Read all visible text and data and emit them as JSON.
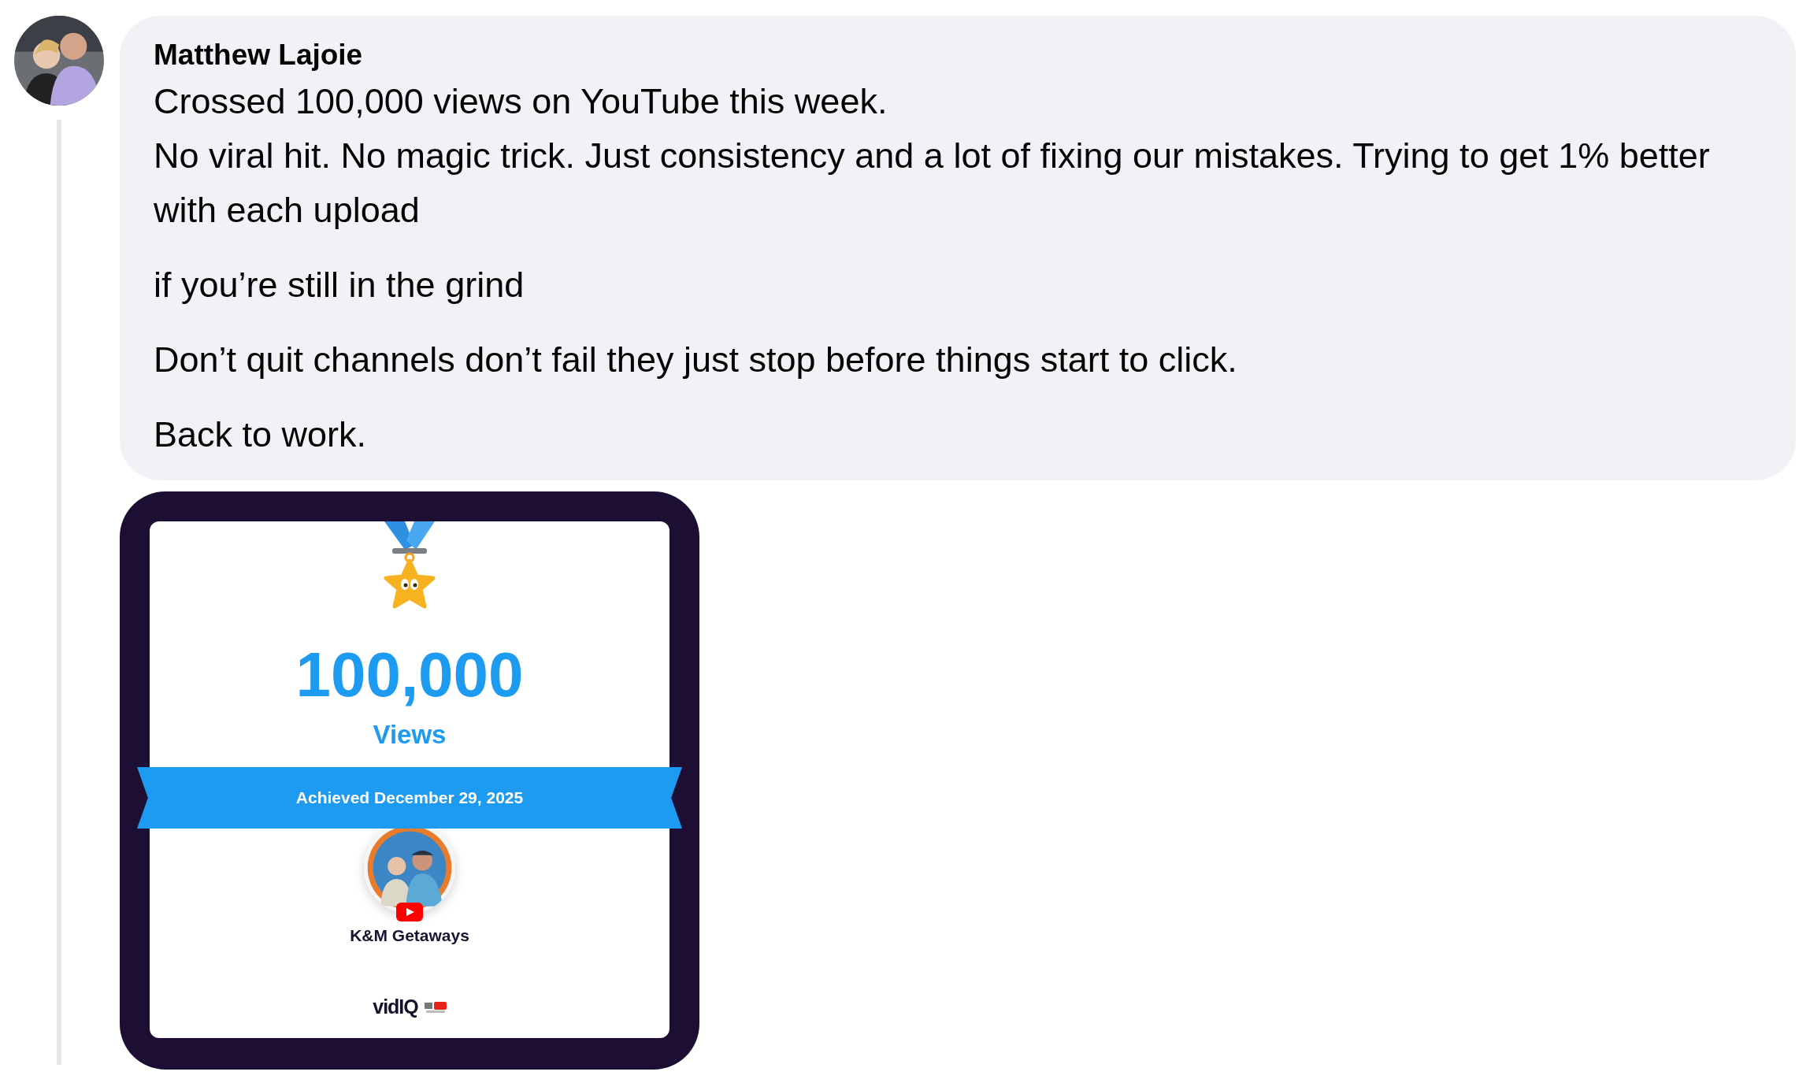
{
  "comment": {
    "author": "Matthew Lajoie",
    "paragraphs": [
      {
        "lines": [
          "Crossed 100,000 views on YouTube this week.",
          "No viral hit. No magic trick. Just consistency and a lot of fixing our mistakes. Trying to get 1% better with each upload"
        ]
      },
      {
        "lines": [
          "if you’re still in the grind"
        ]
      },
      {
        "lines": [
          "Don’t quit channels don’t fail they just stop before things start to click."
        ]
      },
      {
        "lines": [
          "Back to work."
        ]
      }
    ]
  },
  "attachment": {
    "count": "100,000",
    "unit": "Views",
    "achieved": "Achieved December 29, 2025",
    "channel": "K&M Getaways",
    "brand": "vidIQ"
  }
}
